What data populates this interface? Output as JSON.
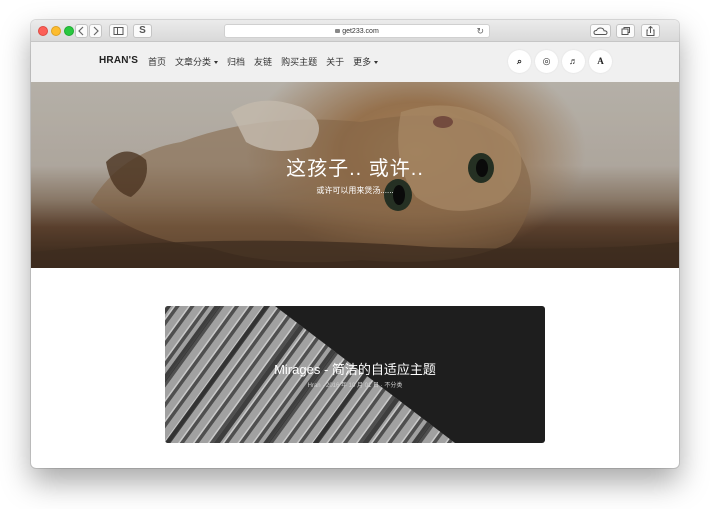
{
  "browser": {
    "url": "get233.com",
    "sidebar_glyph": "☐",
    "extension_glyph": "S",
    "plus_glyph": "+",
    "icons": [
      "back-icon",
      "forward-icon",
      "sidebar-icon",
      "lock-icon",
      "reload-icon",
      "cloud-icon",
      "tabs-icon",
      "share-icon"
    ]
  },
  "nav": {
    "logo": "HRAN'S",
    "items": [
      {
        "label": "首页"
      },
      {
        "label": "文章分类",
        "dropdown": true
      },
      {
        "label": "归档"
      },
      {
        "label": "友链"
      },
      {
        "label": "购买主题"
      },
      {
        "label": "关于"
      },
      {
        "label": "更多",
        "dropdown": true
      }
    ],
    "icon_buttons": [
      {
        "icon": "search-icon",
        "glyph": "⌕"
      },
      {
        "icon": "github-icon",
        "glyph": "◎"
      },
      {
        "icon": "music-icon",
        "glyph": "♬"
      },
      {
        "icon": "font-icon",
        "glyph": "A"
      }
    ]
  },
  "hero": {
    "title": "这孩子.. 或许..",
    "subtitle": "或许可以用来煲汤......"
  },
  "post": {
    "title": "Mirages - 简洁的自适应主题",
    "meta": "Hran · 2016 年 10 月 01 日 · 不分类"
  },
  "colors": {
    "navbar_bg": "#f0f0f0",
    "card_bg": "#232323",
    "traffic_red": "#fc5f57",
    "traffic_yellow": "#fdbc2e",
    "traffic_green": "#29c840"
  }
}
